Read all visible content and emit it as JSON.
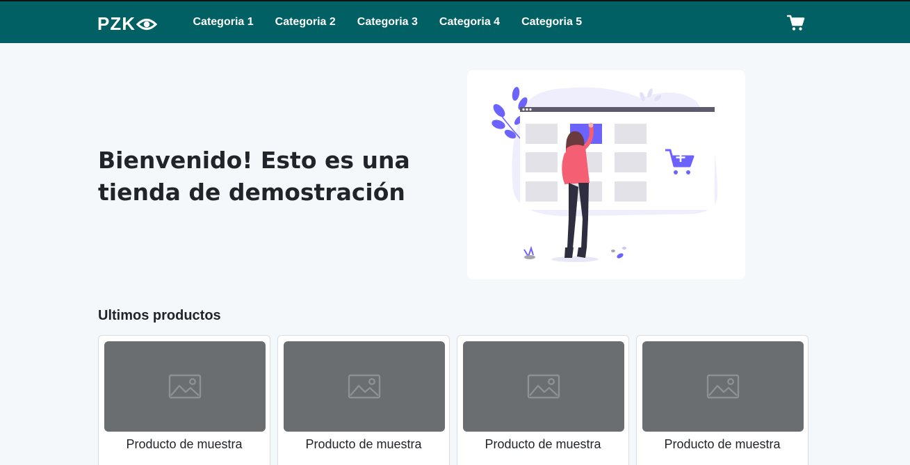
{
  "navbar": {
    "brand": "PZK",
    "links": [
      "Categoria 1",
      "Categoria 2",
      "Categoria 3",
      "Categoria 4",
      "Categoria 5"
    ],
    "cart_icon": "shopping-cart-icon"
  },
  "hero": {
    "title": "Bienvenido! Esto es una tienda de demostración",
    "illustration": "online-shopping-illustration"
  },
  "latest": {
    "title": "Ultimos productos",
    "products": [
      {
        "name": "Producto de muestra",
        "image_icon": "image-placeholder-icon"
      },
      {
        "name": "Producto de muestra",
        "image_icon": "image-placeholder-icon"
      },
      {
        "name": "Producto de muestra",
        "image_icon": "image-placeholder-icon"
      },
      {
        "name": "Producto de muestra",
        "image_icon": "image-placeholder-icon"
      }
    ]
  },
  "colors": {
    "navbar": "#006064",
    "page_bg": "#f5f8fb",
    "accent": "#6c63ff",
    "figure_shirt": "#f55f73",
    "placeholder": "#6b6e71"
  }
}
